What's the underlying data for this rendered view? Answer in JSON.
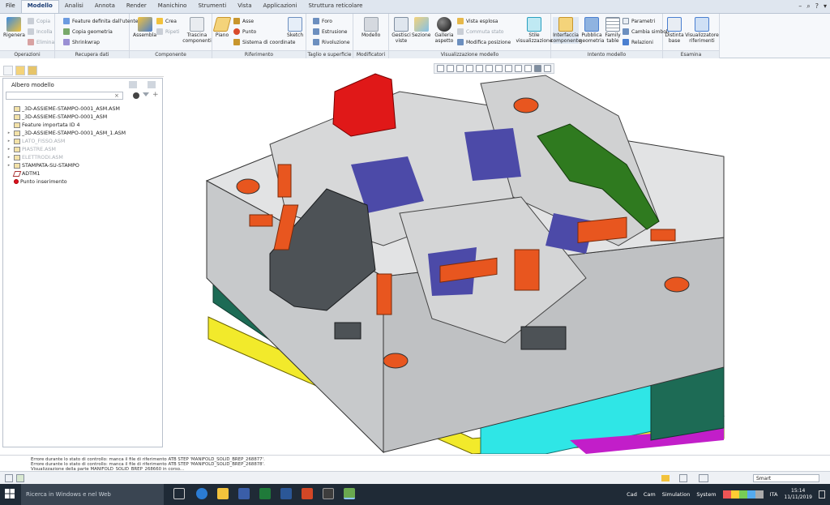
{
  "tabs": [
    "File",
    "Modello",
    "Analisi",
    "Annota",
    "Render",
    "Manichino",
    "Strumenti",
    "Vista",
    "Applicazioni",
    "Struttura reticolare"
  ],
  "active_tab": "Modello",
  "ribbon": {
    "groups": {
      "operazioni": "Operazioni",
      "recupera": "Recupera dati",
      "componente": "Componente",
      "riferimento": "Riferimento",
      "taglio": "Taglio e superficie",
      "modificatori": "Modificatori",
      "visualizzazione": "Visualizzazione modello",
      "intento": "Intento modello",
      "esamina": "Esamina"
    },
    "buttons": {
      "rigenera": "Rigenera",
      "copia": "Copia",
      "incolla": "Incolla",
      "elimina": "Elimina",
      "feature_utente": "Feature definita dall'utente",
      "copia_geometria": "Copia geometria",
      "shrinkwrap": "Shrinkwrap",
      "assembla": "Assembla",
      "crea": "Crea",
      "ripeti": "Ripeti",
      "trascina": "Trascina componenti",
      "piano": "Piano",
      "asse": "Asse",
      "punto": "Punto",
      "sistema": "Sistema di coordinate",
      "sketch": "Sketch",
      "foro": "Foro",
      "estrusione": "Estrusione",
      "rivoluzione": "Rivoluzione",
      "modello": "Modello",
      "gestisci_viste": "Gestisci viste",
      "sezione": "Sezione",
      "galleria": "Galleria aspetto",
      "vista_esplosa": "Vista esplosa",
      "commuta_stato": "Commuta stato",
      "modifica_posizione": "Modifica posizione",
      "stile": "Stile visualizzazione",
      "interfaccia": "Interfaccia componente",
      "pubblica": "Pubblica geometria",
      "family": "Family table",
      "parametri": "Parametri",
      "cambia_simboli": "Cambia simboli",
      "relazioni": "Relazioni",
      "distinta": "Distinta base",
      "visualizzatore": "Visualizzatore riferimenti"
    }
  },
  "model_tree": {
    "title": "Albero modello",
    "items": [
      {
        "label": "_3D-ASSIEME-STAMPO-0001_ASM.ASM",
        "dim": false,
        "expand": ""
      },
      {
        "label": "_3D-ASSIEME-STAMPO-0001_ASM",
        "dim": false,
        "expand": ""
      },
      {
        "label": "Feature importata ID 4",
        "dim": false,
        "expand": ""
      },
      {
        "label": "_3D-ASSIEME-STAMPO-0001_ASM_1.ASM",
        "dim": false,
        "expand": "▸"
      },
      {
        "label": "LATO_FISSO.ASM",
        "dim": true,
        "expand": "▸"
      },
      {
        "label": "PIASTRE.ASM",
        "dim": true,
        "expand": "▸"
      },
      {
        "label": "ELETTRODI.ASM",
        "dim": true,
        "expand": "▸"
      },
      {
        "label": "STAMPATA-SU-STAMPO",
        "dim": false,
        "expand": "▸"
      },
      {
        "label": "ADTM1",
        "dim": false,
        "expand": ""
      },
      {
        "label": "Punto inserimento",
        "dim": false,
        "expand": ""
      }
    ]
  },
  "messages": [
    "Errore durante lo stato di controllo: manca il file di riferimento ATB STEP 'MANIFOLD_SOLID_BREP_268877'.",
    "Errore durante lo stato di controllo: manca il file di riferimento ATB STEP 'MANIFOLD_SOLID_BREP_268878'.",
    "Visualizzazione della parte MANIFOLD_SOLID_BREP_268660 in corso..."
  ],
  "filter": "Smart",
  "taskbar": {
    "search": "Ricerca in Windows e nel Web",
    "right_items": [
      "Cad",
      "Cam",
      "Simulation",
      "System"
    ],
    "lang": "ITA",
    "time": "15:14",
    "date": "11/11/2019"
  },
  "colors": {
    "mold_grey": "#d9dadb",
    "orange": "#e8561f",
    "red": "#e01818",
    "green": "#2f7a1f",
    "dark_grey": "#4d5256",
    "yellow": "#f2ea2b",
    "cyan": "#1fe0e0",
    "teal": "#1d6b55",
    "blue_mesh": "#4c4aa8"
  }
}
